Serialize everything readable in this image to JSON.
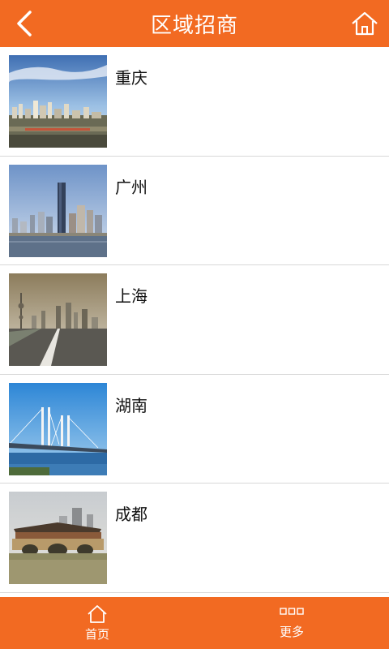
{
  "header": {
    "title": "区域招商",
    "back_icon": "chevron-left-icon",
    "home_icon": "home-icon"
  },
  "colors": {
    "accent": "#f26a22",
    "divider": "#d8d8d8",
    "text": "#111111"
  },
  "regions": [
    {
      "name": "重庆",
      "image": "chongqing-city-skyline-photo"
    },
    {
      "name": "广州",
      "image": "guangzhou-skyline-photo"
    },
    {
      "name": "上海",
      "image": "shanghai-road-skyline-photo"
    },
    {
      "name": "湖南",
      "image": "hunan-bridge-photo"
    },
    {
      "name": "成都",
      "image": "chengdu-covered-bridge-photo"
    }
  ],
  "tabbar": {
    "home_label": "首页",
    "home_icon": "home-icon",
    "more_label": "更多",
    "more_icon": "more-dots-icon"
  }
}
